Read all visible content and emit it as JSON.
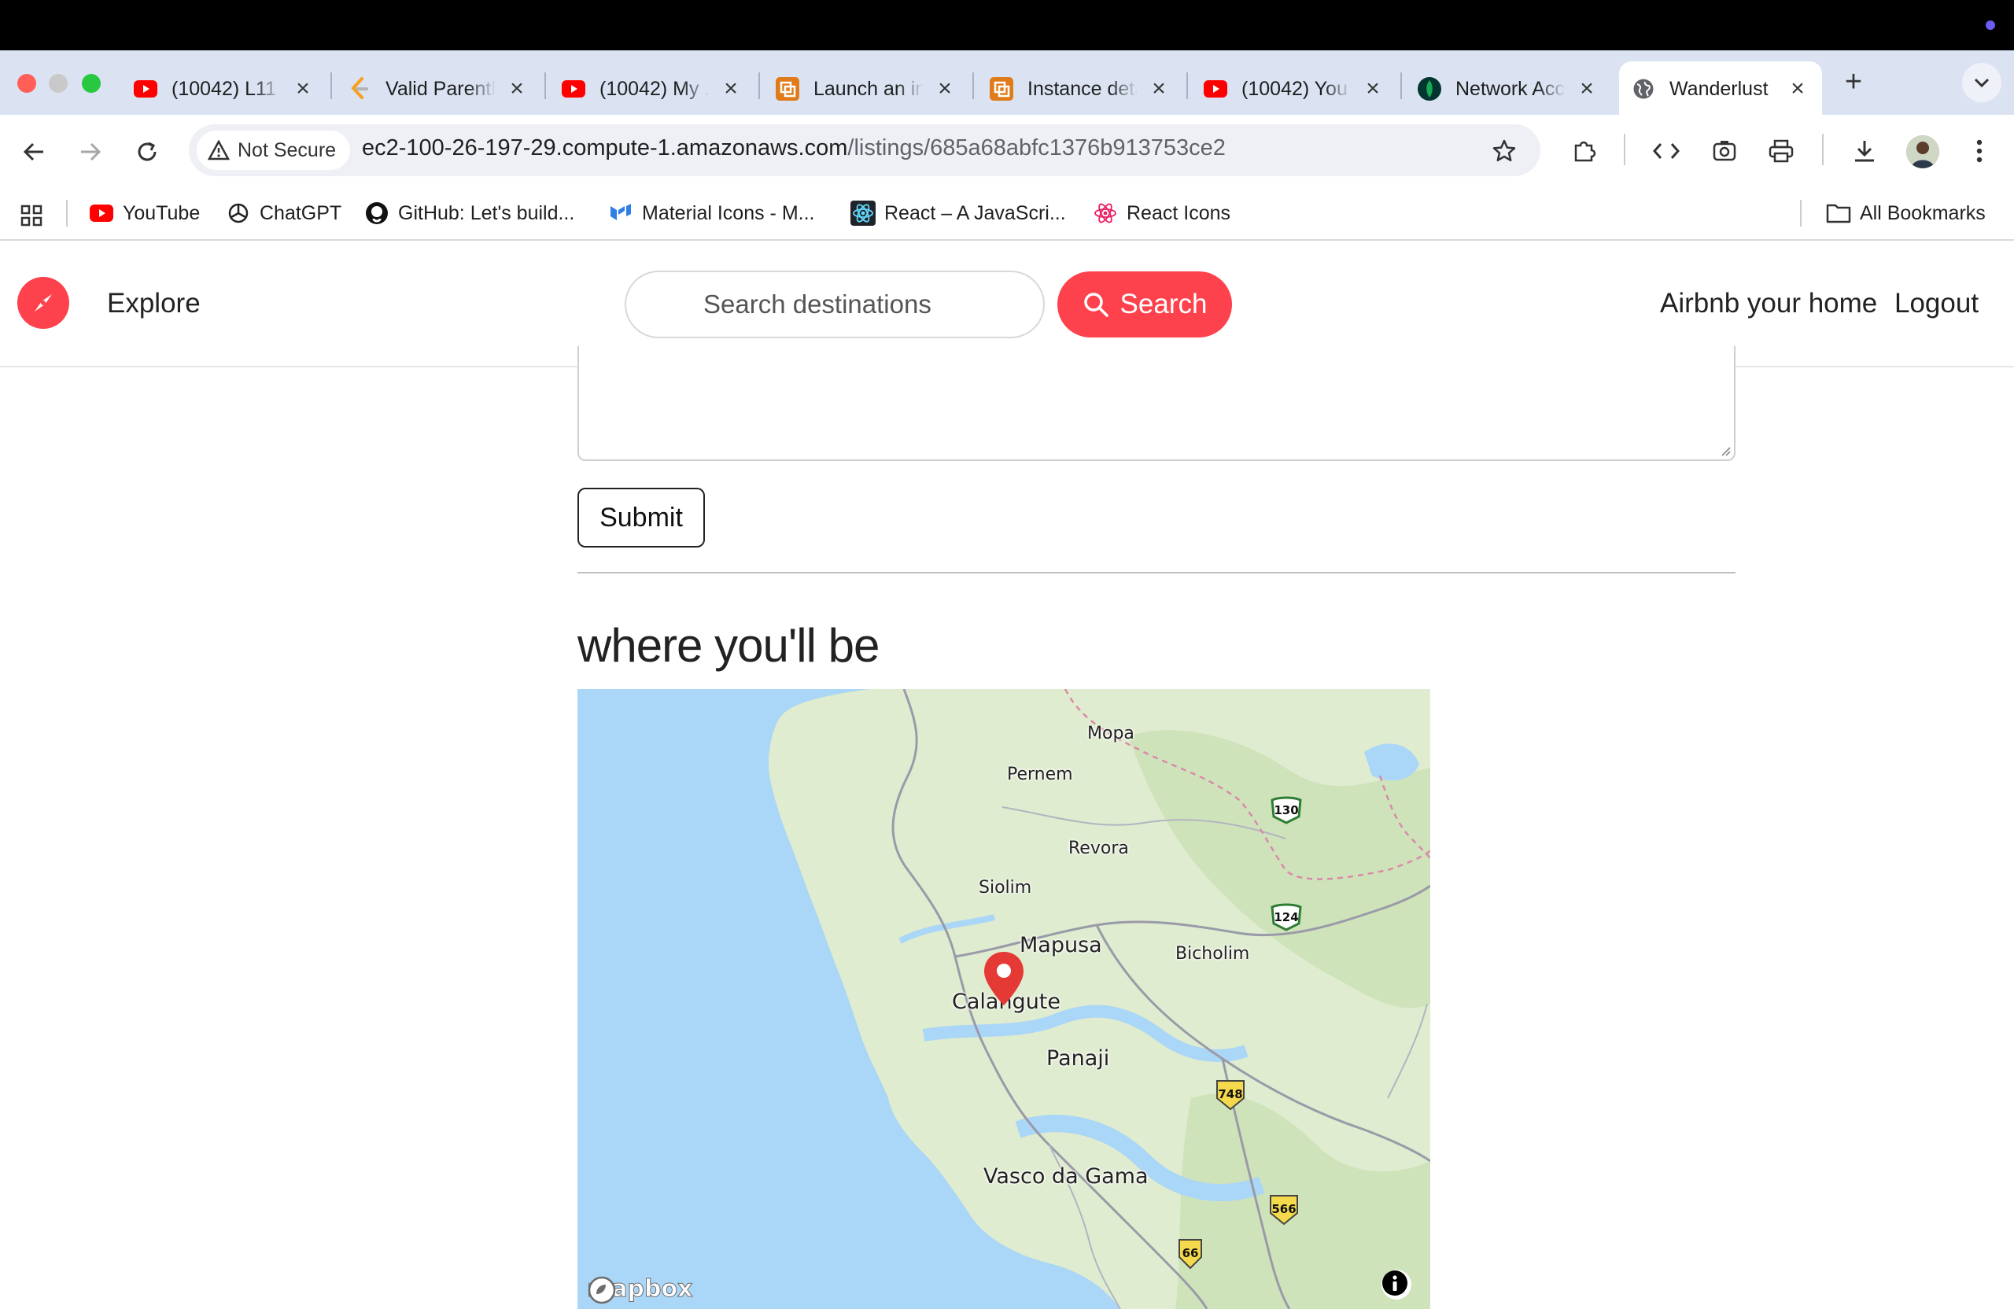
{
  "browser": {
    "tabs": [
      {
        "label": "(10042) L11 ...",
        "icon": "youtube-icon"
      },
      {
        "label": "Valid Parenthese",
        "icon": "leetcode-icon"
      },
      {
        "label": "(10042) My ...",
        "icon": "youtube-icon"
      },
      {
        "label": "Launch an instance",
        "icon": "aws-icon"
      },
      {
        "label": "Instance details",
        "icon": "aws-icon"
      },
      {
        "label": "(10042) You ...",
        "icon": "youtube-icon"
      },
      {
        "label": "Network Access",
        "icon": "mongodb-icon"
      },
      {
        "label": "Wanderlust",
        "icon": "globe-icon",
        "active": true
      }
    ],
    "security_label": "Not Secure",
    "url_host": "ec2-100-26-197-29.compute-1.amazonaws.com",
    "url_path": "/listings/685a68abfc1376b913753ce2",
    "bookmarks": [
      {
        "label": "YouTube",
        "icon": "youtube-icon"
      },
      {
        "label": "ChatGPT",
        "icon": "openai-icon"
      },
      {
        "label": "GitHub: Let's build...",
        "icon": "github-icon"
      },
      {
        "label": "Material Icons - M...",
        "icon": "material-ui-icon"
      },
      {
        "label": "React – A JavaScri...",
        "icon": "react-icon"
      },
      {
        "label": "React Icons",
        "icon": "react-icons-icon"
      }
    ],
    "all_bookmarks": "All Bookmarks"
  },
  "navbar": {
    "explore": "Explore",
    "search_placeholder": "Search destinations",
    "search_button": "Search",
    "host": "Airbnb your home",
    "logout": "Logout"
  },
  "review": {
    "submit": "Submit"
  },
  "location": {
    "heading": "where you'll be",
    "map_cities": [
      {
        "name": "Mopa"
      },
      {
        "name": "Pernem"
      },
      {
        "name": "Revora"
      },
      {
        "name": "Siolim"
      },
      {
        "name": "Mapusa"
      },
      {
        "name": "Bicholim"
      },
      {
        "name": "Calangute"
      },
      {
        "name": "Panaji"
      },
      {
        "name": "Vasco da Gama"
      }
    ],
    "road_shields": [
      "130",
      "124",
      "748",
      "566",
      "66"
    ],
    "attribution": "mapbox",
    "marker_color": "#e53935"
  },
  "colors": {
    "brand": "#fe424d",
    "water": "#aad6f7",
    "land": "#dfeccf"
  }
}
